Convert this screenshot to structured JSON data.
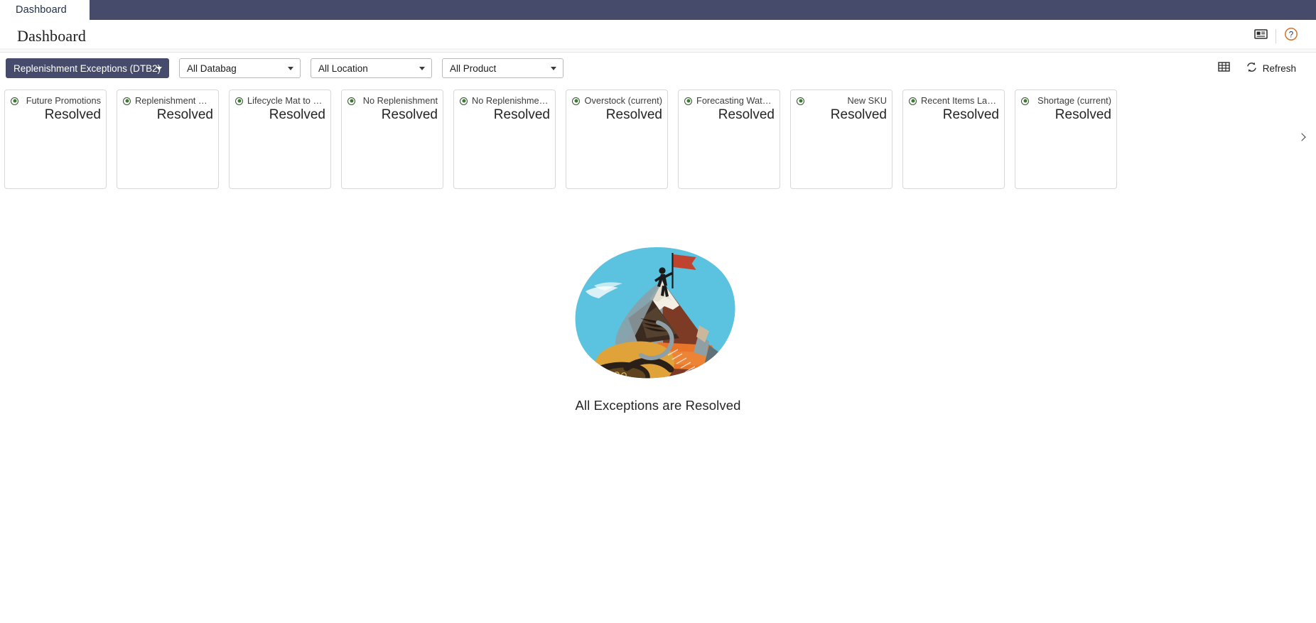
{
  "topbar": {
    "tabs": [
      {
        "label": "Dashboard",
        "active": true
      }
    ],
    "background_color": "#464b6b"
  },
  "titlebar": {
    "title": "Dashboard",
    "actions": [
      {
        "name": "news-icon",
        "label": "News"
      },
      {
        "name": "help-icon",
        "label": "Help"
      }
    ]
  },
  "filters": {
    "dashboard_select": {
      "value": "Replenishment Exceptions (DTB2)",
      "selected": true
    },
    "databag_select": {
      "value": "All Databag"
    },
    "location_select": {
      "value": "All Location"
    },
    "product_select": {
      "value": "All Product"
    },
    "table_view_icon": "table-icon",
    "refresh_label": "Refresh",
    "refresh_icon": "refresh-icon"
  },
  "cards": {
    "status_value": "Resolved",
    "items": [
      {
        "label": "Future Promotions",
        "value": "Resolved",
        "status": "resolved"
      },
      {
        "label": "Replenishment Wat…",
        "value": "Resolved",
        "status": "resolved"
      },
      {
        "label": "Lifecycle Mat to EOL",
        "value": "Resolved",
        "status": "resolved"
      },
      {
        "label": "No Replenishment",
        "value": "Resolved",
        "status": "resolved"
      },
      {
        "label": "No Replenishment …",
        "value": "Resolved",
        "status": "resolved"
      },
      {
        "label": "Overstock (current)",
        "value": "Resolved",
        "status": "resolved"
      },
      {
        "label": "Forecasting Watch-…",
        "value": "Resolved",
        "status": "resolved"
      },
      {
        "label": "New SKU",
        "value": "Resolved",
        "status": "resolved"
      },
      {
        "label": "Recent Items Launch",
        "value": "Resolved",
        "status": "resolved"
      },
      {
        "label": "Shortage (current)",
        "value": "Resolved",
        "status": "resolved"
      }
    ],
    "next_arrow_icon": "chevron-right-icon",
    "status_color": "#3f7a32"
  },
  "empty_state": {
    "message": "All Exceptions are Resolved",
    "illustration": "mountain-climber-flag-illustration",
    "colors": {
      "sky": "#5bc2df",
      "flag": "#c0432f",
      "rock_dark": "#3b2a20",
      "rock_brown": "#7d3a24",
      "sand": "#e0a33a",
      "slate": "#7b8e94",
      "orange": "#e8752a",
      "snow": "#f4efe4"
    }
  }
}
